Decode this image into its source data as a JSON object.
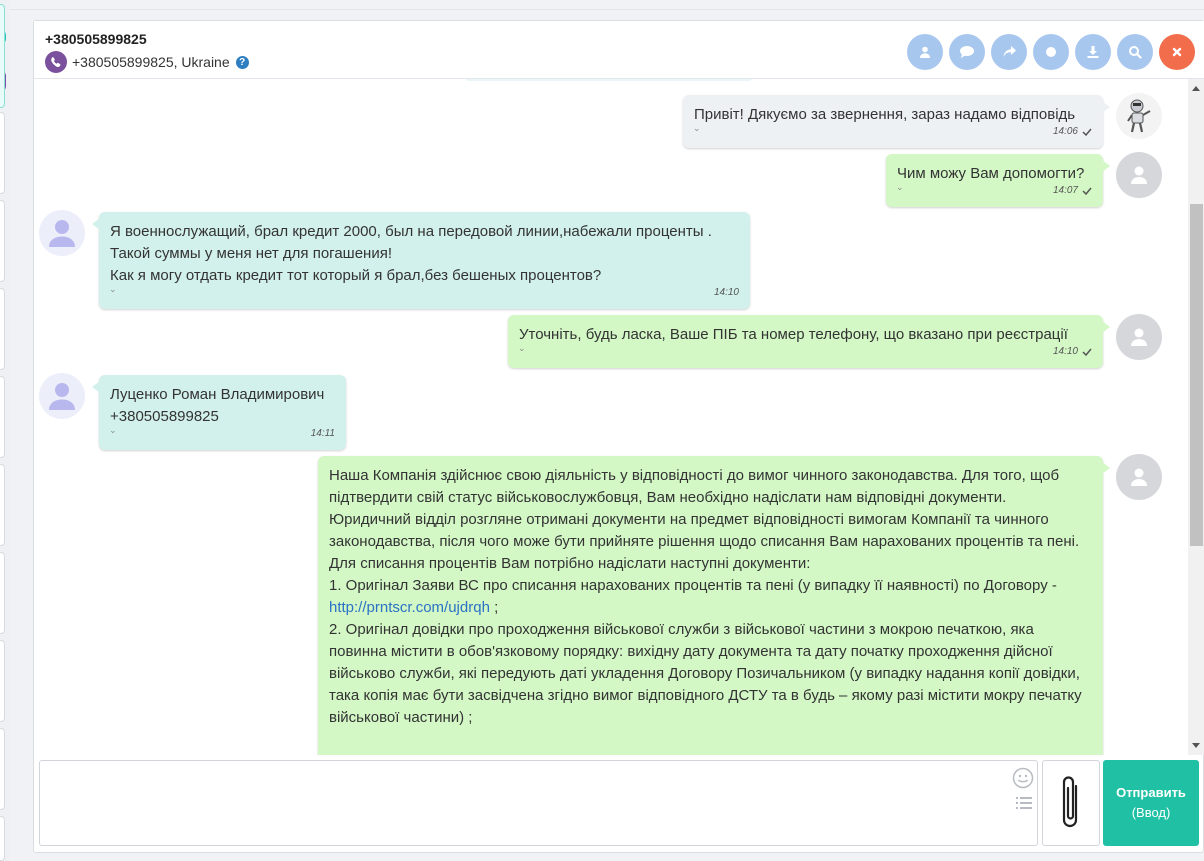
{
  "header": {
    "title": "+380505899825",
    "subtitle": "+380505899825, Ukraine",
    "help_icon": "?",
    "actions": [
      {
        "name": "user-icon"
      },
      {
        "name": "chat-icon"
      },
      {
        "name": "forward-icon"
      },
      {
        "name": "record-icon"
      },
      {
        "name": "download-icon"
      },
      {
        "name": "search-icon"
      },
      {
        "name": "close-icon"
      }
    ]
  },
  "messages": [
    {
      "from": "bot",
      "text": "Привіт! Дякуємо за звернення, зараз надамо відповідь",
      "time": "14:06"
    },
    {
      "from": "operator",
      "text": "Чим можу Вам допомогти?",
      "time": "14:07"
    },
    {
      "from": "client",
      "text": "Я военнослужащий, брал кредит 2000, был на передовой линии,набежали проценты .\nТакой суммы у меня нет для погашения!\nКак я могу отдать кредит тот который я брал,без бешеных процентов?",
      "time": "14:10"
    },
    {
      "from": "operator",
      "text": "Уточніть, будь ласка, Ваше ПІБ та номер телефону, що вказано при реєстрації",
      "time": "14:10"
    },
    {
      "from": "client",
      "text": "Луценко Роман Владимирович\n+380505899825",
      "time": "14:11"
    },
    {
      "from": "operator",
      "text_part1": "Наша Компанія здійснює свою діяльність у відповідності до вимог чинного законодавства. Для того, щоб  підтвердити свій статус військовослужбовця, Вам необхідно надіслати нам відповідні документи. Юридичний відділ розгляне отримані документи на предмет відповідності вимогам Компанії та чинного законодавства, після чого може бути прийняте рішення щодо списання Вам нарахованих процентів та пені.\nДля списання процентів Вам потрібно надіслати наступні документи:\n1.  Оригінал Заяви ВС про списання нарахованих процентів та пені (у випадку її наявності) по Договору - ",
      "link": "http://prntscr.com/ujdrqh",
      "text_part2": " ;\n2. Оригінал довідки про проходження військової служби з військової частини з мокрою печаткою, яка повинна містити в обов'язковому порядку: вихідну дату документа та дату початку проходження дійсної військово служби, які  передують даті укладення Договору Позичальником (у випадку надання копії довідки, така копія має бути засвідчена згідно вимог відповідного ДСТУ та в будь – якому разі містити мокру печатку військової частини) ;"
    }
  ],
  "composer": {
    "placeholder": "",
    "value": ""
  },
  "send": {
    "label": "Отправить",
    "hint": "(Ввод)"
  }
}
